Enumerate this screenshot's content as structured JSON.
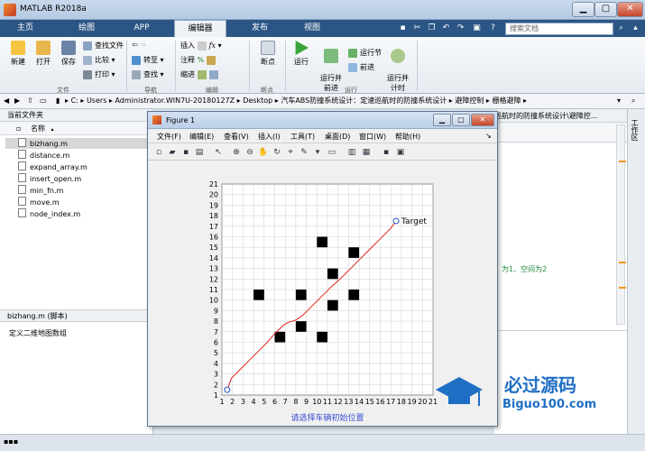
{
  "window": {
    "title": "MATLAB R2018a",
    "controls": {
      "min": "▁",
      "max": "▢",
      "close": "✕"
    }
  },
  "tabs": [
    "主页",
    "绘图",
    "APP",
    "编辑器",
    "发布",
    "视图"
  ],
  "active_tab": "编辑器",
  "search": {
    "placeholder": "搜索文档"
  },
  "ribbon": {
    "file": {
      "new": "新建",
      "open": "打开",
      "save": "保存",
      "find_files": "查找文件",
      "compare": "比较",
      "print": "打印",
      "label": "文件"
    },
    "navigate": {
      "goto": "转至",
      "find": "查找",
      "label": "导航"
    },
    "edit": {
      "insert": "插入",
      "comment": "注释",
      "indent": "缩进",
      "fx": "fx",
      "label": "编辑"
    },
    "breakpoints": {
      "button": "断点",
      "label": "断点"
    },
    "run": {
      "run": "运行",
      "run_advance": "运行并\n前进",
      "run_section": "运行节",
      "advance": "前进",
      "run_time": "运行并\n计时",
      "label": "运行"
    }
  },
  "address": {
    "parts": [
      "C:",
      "Users",
      "Administrator.WIN7U-20180127Z",
      "Desktop",
      "汽车ABS防撞系统设计：定速巡航时的防撞系统设计",
      "避障控制",
      "栅格避障"
    ]
  },
  "current_folder": {
    "header": "当前文件夹",
    "column": "名称",
    "files": [
      "bizhang.m",
      "distance.m",
      "expand_array.m",
      "insert_open.m",
      "min_fn.m",
      "move.m",
      "node_index.m"
    ],
    "selected": "bizhang.m"
  },
  "details": {
    "header": "bizhang.m  (脚本)",
    "text": "定义二维地图数组"
  },
  "right_panel": {
    "path_tail": "巡航时的防撞系统设计\\避障控...",
    "note": "、为1、空间为2",
    "workspace": "工作区"
  },
  "figure": {
    "title": "Figure 1",
    "menu": [
      "文件(F)",
      "编辑(E)",
      "查看(V)",
      "插入(I)",
      "工具(T)",
      "桌面(D)",
      "窗口(W)",
      "帮助(H)"
    ]
  },
  "chart_data": {
    "type": "line",
    "xlim": [
      1,
      21
    ],
    "ylim": [
      1,
      21
    ],
    "x_ticks": [
      1,
      2,
      3,
      4,
      5,
      6,
      7,
      8,
      9,
      10,
      11,
      12,
      13,
      14,
      15,
      16,
      17,
      18,
      19,
      20,
      21
    ],
    "y_ticks": [
      1,
      2,
      3,
      4,
      5,
      6,
      7,
      8,
      9,
      10,
      11,
      12,
      13,
      14,
      15,
      16,
      17,
      18,
      19,
      20,
      21
    ],
    "grid": true,
    "xlabel": "请选择车辆初始位置",
    "ylabel": "",
    "title": "",
    "obstacles": [
      {
        "x": 4.5,
        "y": 10.5
      },
      {
        "x": 6.5,
        "y": 6.5
      },
      {
        "x": 8.5,
        "y": 10.5
      },
      {
        "x": 8.5,
        "y": 7.5
      },
      {
        "x": 10.5,
        "y": 15.5
      },
      {
        "x": 10.5,
        "y": 6.5
      },
      {
        "x": 11.5,
        "y": 12.5
      },
      {
        "x": 11.5,
        "y": 9.5
      },
      {
        "x": 13.5,
        "y": 14.5
      },
      {
        "x": 13.5,
        "y": 10.5
      }
    ],
    "path": [
      [
        1.5,
        1.5
      ],
      [
        1.9,
        2.6
      ],
      [
        2.6,
        3.3
      ],
      [
        3.4,
        4.1
      ],
      [
        4.3,
        5.0
      ],
      [
        5.2,
        5.9
      ],
      [
        6.0,
        6.8
      ],
      [
        6.8,
        7.6
      ],
      [
        7.3,
        7.9
      ],
      [
        8.0,
        8.1
      ],
      [
        8.7,
        8.6
      ],
      [
        9.5,
        9.4
      ],
      [
        10.4,
        10.3
      ],
      [
        11.3,
        11.2
      ],
      [
        12.2,
        12.0
      ],
      [
        13.1,
        12.9
      ],
      [
        14.0,
        13.8
      ],
      [
        15.0,
        14.8
      ],
      [
        16.0,
        15.8
      ],
      [
        17.0,
        16.8
      ],
      [
        17.5,
        17.5
      ]
    ],
    "start": {
      "x": 1.5,
      "y": 1.5
    },
    "target": {
      "x": 17.5,
      "y": 17.5,
      "label": "Target"
    },
    "colors": {
      "path": "#e02020",
      "marker": "#1f4fbf",
      "obstacle": "#000000",
      "xlabel": "#3a4fd0"
    }
  },
  "watermark": {
    "cn": "必过源码",
    "url": "Biguo100.com"
  }
}
